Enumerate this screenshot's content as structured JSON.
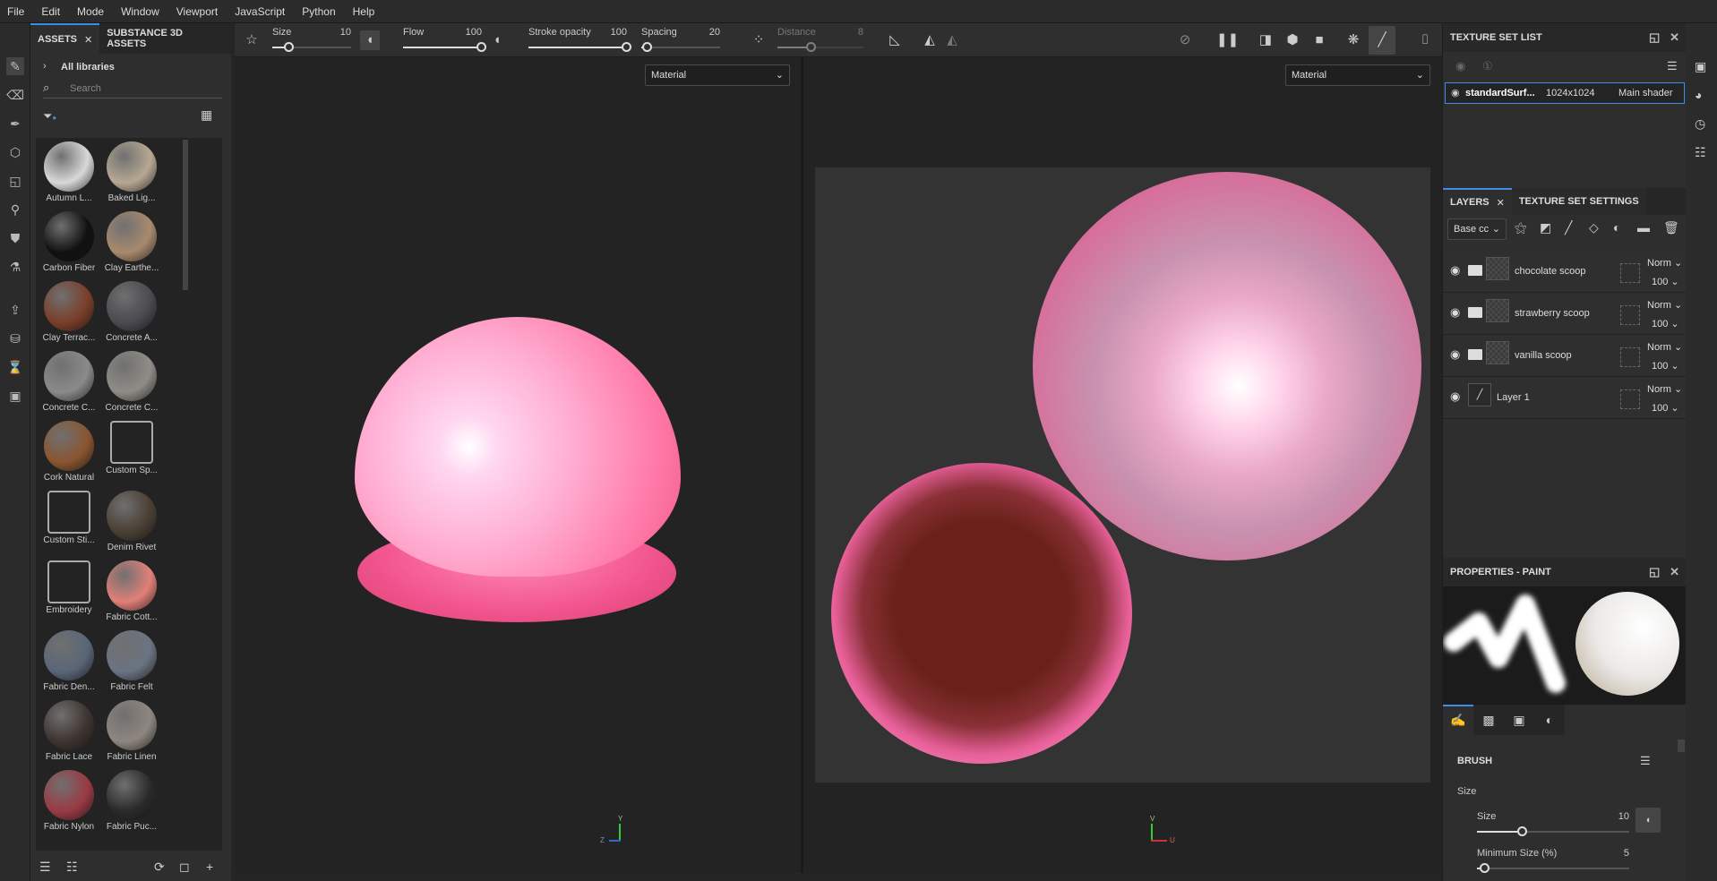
{
  "menu": [
    "File",
    "Edit",
    "Mode",
    "Window",
    "Viewport",
    "JavaScript",
    "Python",
    "Help"
  ],
  "assets": {
    "tabs": [
      "ASSETS",
      "SUBSTANCE 3D ASSETS"
    ],
    "library": "All libraries",
    "search_placeholder": "Search",
    "items": [
      {
        "label": "Autumn L...",
        "color": "#d8d8d8"
      },
      {
        "label": "Baked Lig...",
        "color": "#b7a893"
      },
      {
        "label": "Carbon Fiber",
        "color": "#111111"
      },
      {
        "label": "Clay Earthe...",
        "color": "#a88a6e"
      },
      {
        "label": "Clay Terrac...",
        "color": "#7a3e2a"
      },
      {
        "label": "Concrete A...",
        "color": "#4a4a50"
      },
      {
        "label": "Concrete C...",
        "color": "#8a8a8a"
      },
      {
        "label": "Concrete C...",
        "color": "#8e8c86"
      },
      {
        "label": "Cork Natural",
        "color": "#8a5530"
      },
      {
        "label": "Custom Sp...",
        "color": "icon"
      },
      {
        "label": "Custom Sti...",
        "color": "icon"
      },
      {
        "label": "Denim Rivet",
        "color": "#4a3f34"
      },
      {
        "label": "Embroidery",
        "color": "icon"
      },
      {
        "label": "Fabric Cott...",
        "color": "#e08078"
      },
      {
        "label": "Fabric Den...",
        "color": "#5a6678"
      },
      {
        "label": "Fabric Felt",
        "color": "#6a7482"
      },
      {
        "label": "Fabric Lace",
        "color": "#3e3430"
      },
      {
        "label": "Fabric Linen",
        "color": "#8e8680"
      },
      {
        "label": "Fabric Nylon",
        "color": "#9a3a44"
      },
      {
        "label": "Fabric Puc...",
        "color": "#2a2a2a"
      }
    ]
  },
  "toolbar": {
    "size": {
      "label": "Size",
      "value": "10",
      "pct": 0.22
    },
    "flow": {
      "label": "Flow",
      "value": "100",
      "pct": 1
    },
    "stroke_opacity": {
      "label": "Stroke opacity",
      "value": "100",
      "pct": 1
    },
    "spacing": {
      "label": "Spacing",
      "value": "20",
      "pct": 0.08
    },
    "distance": {
      "label": "Distance",
      "value": "8",
      "pct": 0.4
    }
  },
  "viewport3d": {
    "mode": "Material",
    "axis_y": "Y",
    "axis_z": "Z"
  },
  "viewport2d": {
    "mode": "Material",
    "axis_v": "V",
    "axis_u": "U"
  },
  "texture_set_list": {
    "title": "TEXTURE SET LIST",
    "row": {
      "name": "standardSurf...",
      "resolution": "1024x1024",
      "shader": "Main shader"
    }
  },
  "layers": {
    "tabs": [
      "LAYERS",
      "TEXTURE SET SETTINGS"
    ],
    "channel": "Base cc",
    "items": [
      {
        "name": "chocolate scoop",
        "type": "folder",
        "blend": "Norm",
        "opacity": "100"
      },
      {
        "name": "strawberry scoop",
        "type": "folder",
        "blend": "Norm",
        "opacity": "100"
      },
      {
        "name": "vanilla scoop",
        "type": "folder",
        "blend": "Norm",
        "opacity": "100"
      },
      {
        "name": "Layer 1",
        "type": "paint",
        "blend": "Norm",
        "opacity": "100"
      }
    ]
  },
  "properties": {
    "title": "PROPERTIES - PAINT",
    "section": "BRUSH",
    "group": "Size",
    "size": {
      "label": "Size",
      "value": "10",
      "pct": 0.3
    },
    "min_size": {
      "label": "Minimum Size (%)",
      "value": "5",
      "pct": 0.05
    }
  }
}
